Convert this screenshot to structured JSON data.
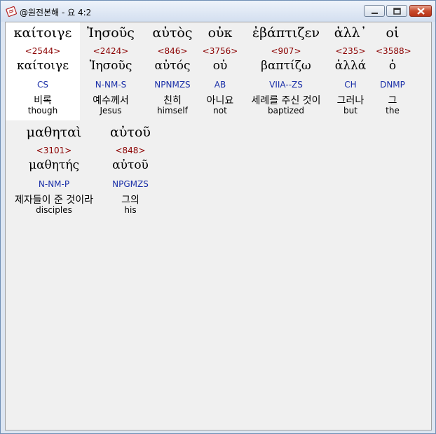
{
  "window": {
    "title": "@원전본해 - 요 4:2",
    "icon": "bible-app-icon"
  },
  "words": [
    {
      "greek": "καίτοιγε",
      "strong": "<2544>",
      "lexeme": "καίτοιγε",
      "morph": "CS",
      "korean": "비록",
      "english": "though",
      "selected": true
    },
    {
      "greek": "Ἰησοῦς",
      "strong": "<2424>",
      "lexeme": "Ἰησοῦς",
      "morph": "N-NM-S",
      "korean": "예수께서",
      "english": "Jesus"
    },
    {
      "greek": "αὐτὸς",
      "strong": "<846>",
      "lexeme": "αὐτός",
      "morph": "NPNMZS",
      "korean": "친히",
      "english": "himself"
    },
    {
      "greek": "οὐκ",
      "strong": "<3756>",
      "lexeme": "οὐ",
      "morph": "AB",
      "korean": "아니요",
      "english": "not"
    },
    {
      "greek": "ἐβάπτιζεν",
      "strong": "<907>",
      "lexeme": "βαπτίζω",
      "morph": "VIIA--ZS",
      "korean": "세례를 주신 것이",
      "english": "baptized"
    },
    {
      "greek": "ἀλλ᾽",
      "strong": "<235>",
      "lexeme": "ἀλλά",
      "morph": "CH",
      "korean": "그러나",
      "english": "but"
    },
    {
      "greek": "οἱ",
      "strong": "<3588>",
      "lexeme": "ὁ",
      "morph": "DNMP",
      "korean": "그",
      "english": "the"
    },
    {
      "greek": "μαθηταὶ",
      "strong": "<3101>",
      "lexeme": "μαθητής",
      "morph": "N-NM-P",
      "korean": "제자들이 준 것이라",
      "english": "disciples"
    },
    {
      "greek": "αὐτοῦ",
      "strong": "<848>",
      "lexeme": "αὐτοῦ",
      "morph": "NPGMZS",
      "korean": "그의",
      "english": "his"
    }
  ]
}
